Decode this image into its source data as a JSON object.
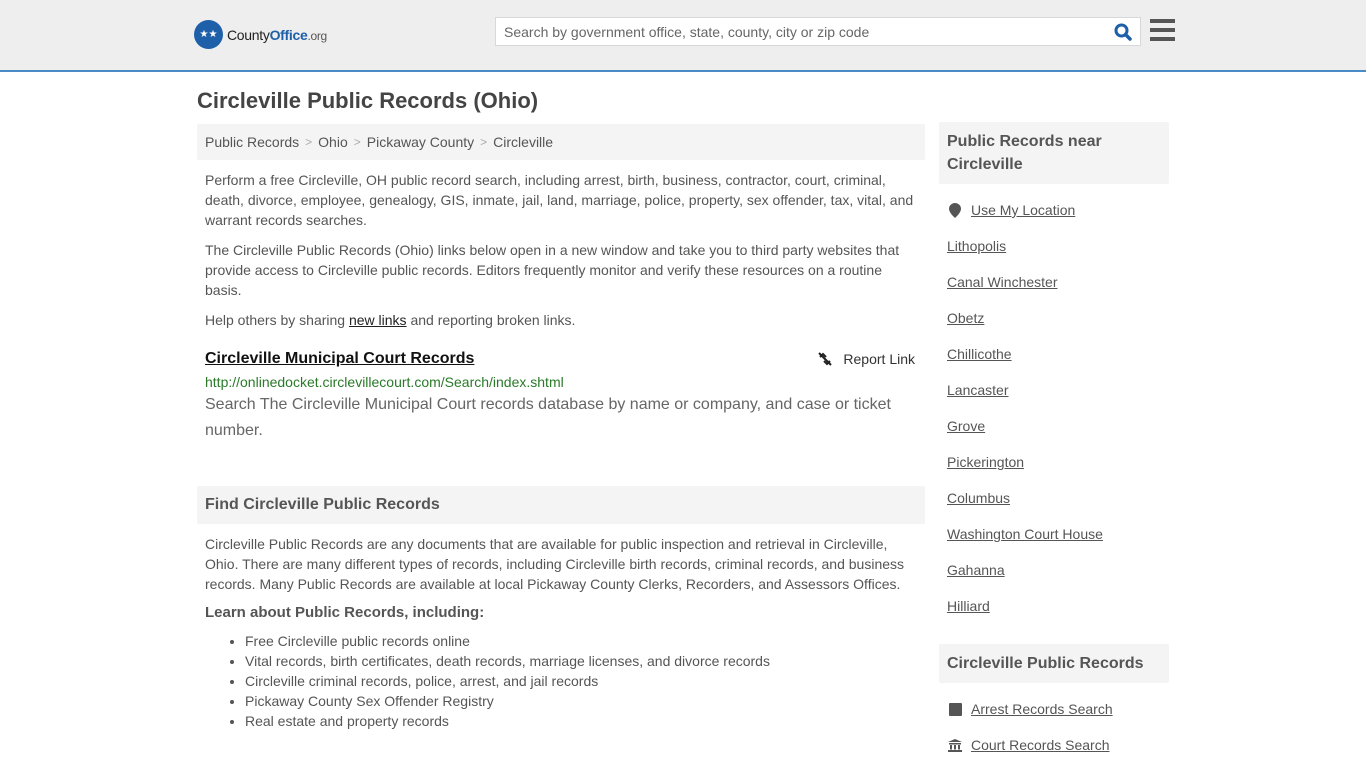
{
  "header": {
    "logo": {
      "county": "County",
      "office": "Office",
      "tld": ".org"
    },
    "search_placeholder": "Search by government office, state, county, city or zip code",
    "search_value": ""
  },
  "page_title": "Circleville Public Records (Ohio)",
  "breadcrumb": [
    "Public Records",
    "Ohio",
    "Pickaway County",
    "Circleville"
  ],
  "intro": {
    "p1": "Perform a free Circleville, OH public record search, including arrest, birth, business, contractor, court, criminal, death, divorce, employee, genealogy, GIS, inmate, jail, land, marriage, police, property, sex offender, tax, vital, and warrant records searches.",
    "p2": "The Circleville Public Records (Ohio) links below open in a new window and take you to third party websites that provide access to Circleville public records. Editors frequently monitor and verify these resources on a routine basis.",
    "p3_before": "Help others by sharing ",
    "p3_link": "new links",
    "p3_after": " and reporting broken links."
  },
  "record": {
    "title": "Circleville Municipal Court Records",
    "report_label": "Report Link",
    "url": "http://onlinedocket.circlevillecourt.com/Search/index.shtml",
    "description": "Search The Circleville Municipal Court records database by name or company, and case or ticket number."
  },
  "find_section": {
    "heading": "Find Circleville Public Records",
    "paragraph": "Circleville Public Records are any documents that are available for public inspection and retrieval in Circleville, Ohio. There are many different types of records, including Circleville birth records, criminal records, and business records. Many Public Records are available at local Pickaway County Clerks, Recorders, and Assessors Offices.",
    "learn_heading": "Learn about Public Records, including:",
    "items": [
      "Free Circleville public records online",
      "Vital records, birth certificates, death records, marriage licenses, and divorce records",
      "Circleville criminal records, police, arrest, and jail records",
      "Pickaway County Sex Offender Registry",
      "Real estate and property records"
    ]
  },
  "sidebar": {
    "near_heading": "Public Records near Circleville",
    "use_location": "Use My Location",
    "nearby": [
      "Lithopolis",
      "Canal Winchester",
      "Obetz",
      "Chillicothe",
      "Lancaster",
      "Grove",
      "Pickerington",
      "Columbus",
      "Washington Court House",
      "Gahanna",
      "Hilliard"
    ],
    "records_heading": "Circleville Public Records",
    "records_links": [
      {
        "label": "Arrest Records Search",
        "icon": "square-icon"
      },
      {
        "label": "Court Records Search",
        "icon": "courthouse-icon"
      }
    ]
  }
}
